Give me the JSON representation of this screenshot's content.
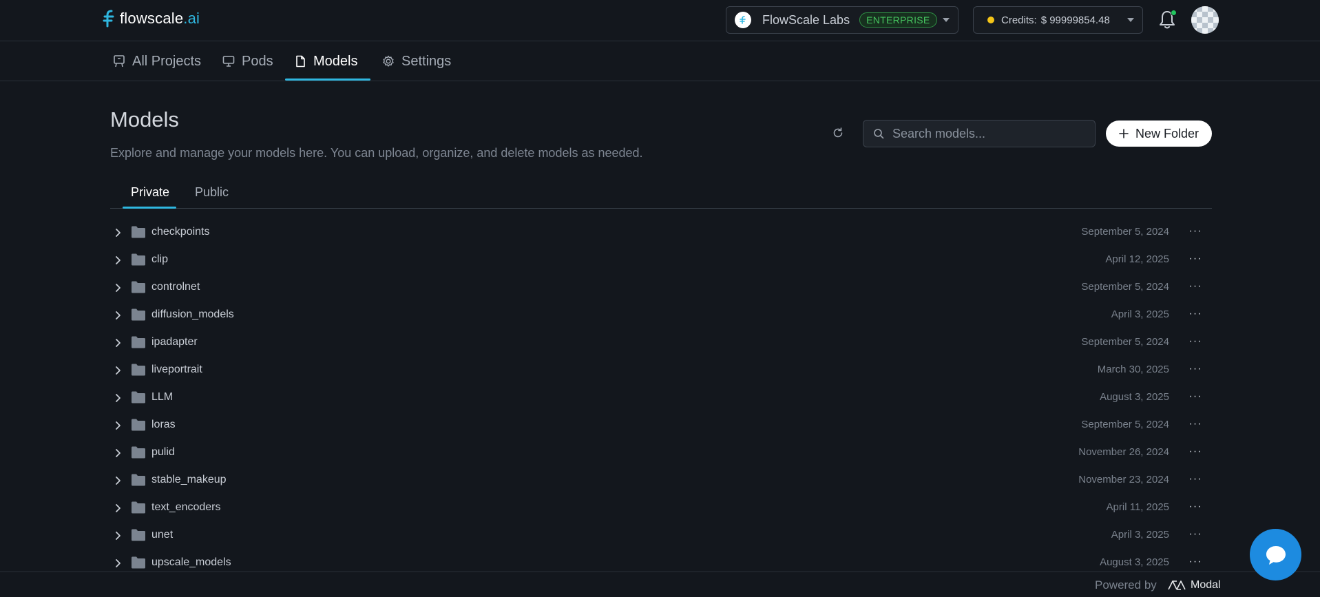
{
  "app": {
    "logo_text": "flowscale",
    "logo_suffix": ".ai"
  },
  "org": {
    "name": "FlowScale Labs",
    "plan_badge": "ENTERPRISE"
  },
  "credits": {
    "label": "Credits:",
    "value": "$ 99999854.48"
  },
  "nav": {
    "items": [
      {
        "label": "All Projects",
        "icon": "board-icon"
      },
      {
        "label": "Pods",
        "icon": "monitor-icon"
      },
      {
        "label": "Models",
        "icon": "file-icon",
        "active": true
      },
      {
        "label": "Settings",
        "icon": "gear-icon"
      }
    ]
  },
  "page": {
    "title": "Models",
    "description": "Explore and manage your models here. You can upload, organize, and delete models as needed."
  },
  "search": {
    "placeholder": "Search models..."
  },
  "toolbar": {
    "new_folder_label": "New Folder"
  },
  "tabs": [
    {
      "label": "Private",
      "active": true
    },
    {
      "label": "Public"
    }
  ],
  "folders": [
    {
      "name": "checkpoints",
      "date": "September 5, 2024"
    },
    {
      "name": "clip",
      "date": "April 12, 2025"
    },
    {
      "name": "controlnet",
      "date": "September 5, 2024"
    },
    {
      "name": "diffusion_models",
      "date": "April 3, 2025"
    },
    {
      "name": "ipadapter",
      "date": "September 5, 2024"
    },
    {
      "name": "liveportrait",
      "date": "March 30, 2025"
    },
    {
      "name": "LLM",
      "date": "August 3, 2025"
    },
    {
      "name": "loras",
      "date": "September 5, 2024"
    },
    {
      "name": "pulid",
      "date": "November 26, 2024"
    },
    {
      "name": "stable_makeup",
      "date": "November 23, 2024"
    },
    {
      "name": "text_encoders",
      "date": "April 11, 2025"
    },
    {
      "name": "unet",
      "date": "April 3, 2025"
    },
    {
      "name": "upscale_models",
      "date": "August 3, 2025"
    }
  ],
  "more_label": "···",
  "footer": {
    "powered_by": "Powered by",
    "brand": "Modal"
  },
  "colors": {
    "accent": "#2fb7e0",
    "enterprise": "#46c35f",
    "chat": "#1d8be0",
    "credit_dot": "#f5c518"
  }
}
